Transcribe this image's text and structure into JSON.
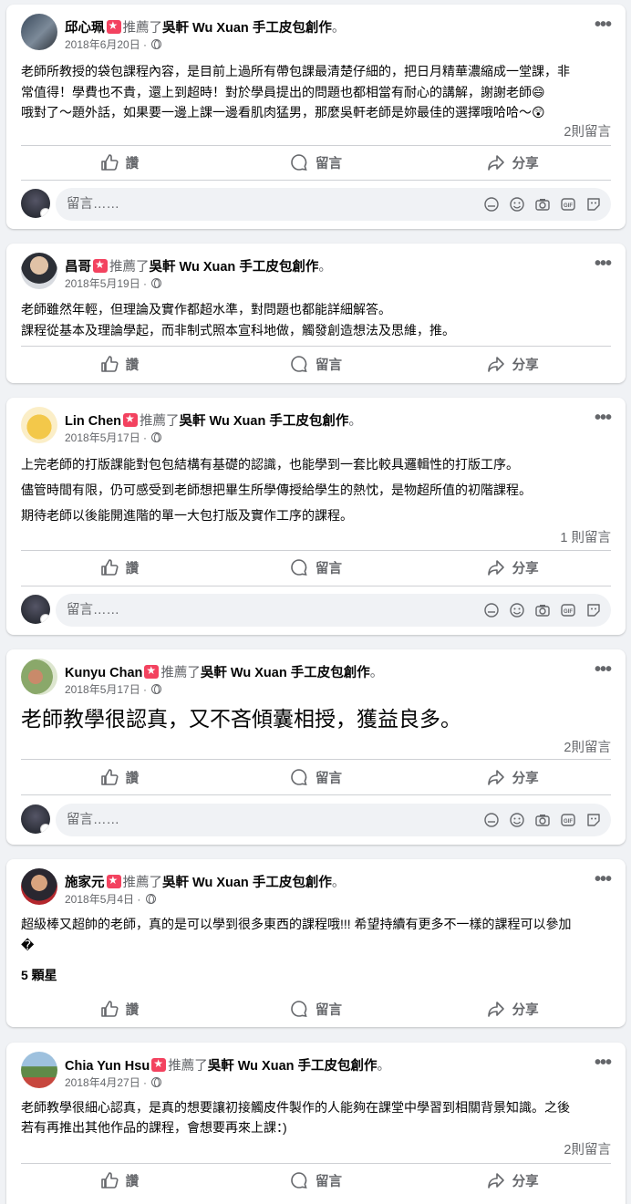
{
  "common": {
    "recommended_verb": "推薦了",
    "page_name": "吳軒 Wu Xuan 手工皮包創作",
    "dot": "。",
    "like_label": "讚",
    "comment_label": "留言",
    "share_label": "分享",
    "comment_placeholder": "留言……",
    "more_label": "•••"
  },
  "posts": [
    {
      "author": "邱心珮",
      "date": "2018年6月20日",
      "lines": [
        "老師所教授的袋包課程內容，是目前上過所有帶包課最清楚仔細的，把日月精華濃縮成一堂課，非",
        "常值得！學費也不貴，還上到超時！對於學員提出的問題也都相當有耐心的講解，謝謝老師😄",
        "哦對了～題外話，如果要一邊上課一邊看肌肉猛男，那麼吳軒老師是妳最佳的選擇哦哈哈～😲"
      ],
      "comment_count": "2則留言"
    },
    {
      "author": "昌哥",
      "date": "2018年5月19日",
      "lines": [
        "老師雖然年輕，但理論及實作都超水準，對問題也都能詳細解答。",
        "課程從基本及理論學起，而非制式照本宣科地做，觸發創造想法及思維，推。"
      ],
      "comment_count": ""
    },
    {
      "author": "Lin Chen",
      "date": "2018年5月17日",
      "lines": [
        "上完老師的打版課能對包包結構有基礎的認識，也能學到一套比較具邏輯性的打版工序。",
        "儘管時間有限，仍可感受到老師想把畢生所學傳授給學生的熱忱，是物超所值的初階課程。",
        "期待老師以後能開進階的單一大包打版及實作工序的課程。"
      ],
      "comment_count": "1 則留言"
    },
    {
      "author": "Kunyu Chan",
      "date": "2018年5月17日",
      "lines": [
        "老師教學很認真，又不吝傾囊相授，獲益良多。"
      ],
      "comment_count": "2則留言"
    },
    {
      "author": "施家元",
      "date": "2018年5月4日",
      "lines": [
        "超級棒又超帥的老師，真的是可以學到很多東西的課程哦!!! 希望持續有更多不一樣的課程可以參加",
        "�"
      ],
      "rating": "5 顆星",
      "comment_count": ""
    },
    {
      "author": "Chia Yun Hsu",
      "date": "2018年4月27日",
      "lines": [
        "老師教學很細心認真，是真的想要讓初接觸皮件製作的人能夠在課堂中學習到相關背景知識。之後",
        "若有再推出其他作品的課程，會想要再來上課：)"
      ],
      "comment_count": "2則留言"
    }
  ]
}
